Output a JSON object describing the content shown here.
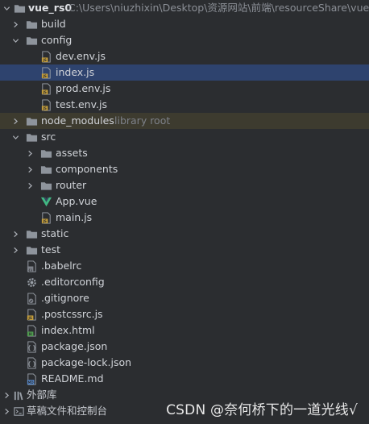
{
  "tree": {
    "root": {
      "name": "vue_rs0",
      "path": "C:\\Users\\niuzhixin\\Desktop\\资源网站\\前端\\resourceShare\\vue_rs0"
    },
    "build": "build",
    "config": "config",
    "config_files": [
      "dev.env.js",
      "index.js",
      "prod.env.js",
      "test.env.js"
    ],
    "node_modules": "node_modules",
    "node_modules_tag": "library root",
    "src": "src",
    "src_folders": [
      "assets",
      "components",
      "router"
    ],
    "src_files": [
      "App.vue",
      "main.js"
    ],
    "static": "static",
    "test": "test",
    "root_files": [
      ".babelrc",
      ".editorconfig",
      ".gitignore",
      ".postcssrc.js",
      "index.html",
      "package.json",
      "package-lock.json",
      "README.md"
    ]
  },
  "bottom": {
    "external_libs": "外部库",
    "scratches": "草稿文件和控制台"
  },
  "watermark": "CSDN @奈何桥下的一道光线√",
  "colors": {
    "background": "#2b2d30",
    "selection": "#2e436e",
    "library_highlight": "#3d3b2f",
    "folder": "#8e949c",
    "js_badge": "#c9a13b",
    "vue_green": "#41b883"
  }
}
